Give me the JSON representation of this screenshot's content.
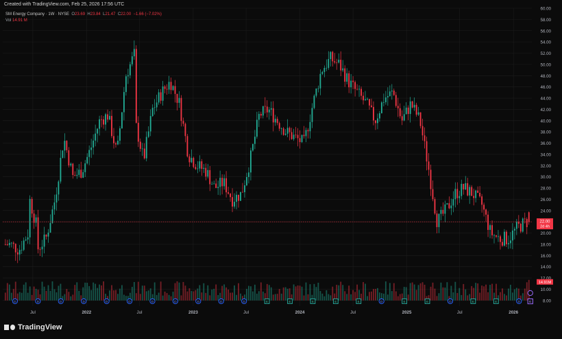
{
  "header": {
    "created_text": "Created with TradingView.com, Feb 25, 2026 17:56 UTC"
  },
  "legend": {
    "symbol_line": "SM Energy Company · 1W · NYSE",
    "o_label": "O",
    "o_value": "23.69",
    "h_label": "H",
    "h_value": "23.84",
    "l_label": "L",
    "l_value": "21.47",
    "c_label": "C",
    "c_value": "22.00",
    "change": "−1.66 (−7.02%)",
    "vol_label": "Vol",
    "vol_value": "14.91 M"
  },
  "footer": {
    "brand": "TradingView"
  },
  "colors": {
    "up": "#22ab94",
    "down": "#f23645",
    "background": "#0b0b0b",
    "grid": "#1c1c1c",
    "text": "#b2b5be"
  },
  "chart_data": {
    "type": "candlestick",
    "symbol": "SM Energy Company",
    "interval": "1W",
    "exchange": "NYSE",
    "last_price": 22.0,
    "last_price_label": "22.00",
    "last_price_countdown": "2d 4h",
    "last_volume_label": "14.91M",
    "y_ticks": [
      "8.00",
      "10.00",
      "12.00",
      "14.00",
      "16.00",
      "18.00",
      "20.00",
      "22.00",
      "24.00",
      "26.00",
      "28.00",
      "30.00",
      "32.00",
      "34.00",
      "36.00",
      "38.00",
      "40.00",
      "42.00",
      "44.00",
      "46.00",
      "48.00",
      "50.00",
      "52.00",
      "54.00",
      "56.00",
      "58.00",
      "60.00"
    ],
    "ylim": [
      7,
      60
    ],
    "x_ticks": [
      "Jul",
      "2022",
      "Jul",
      "2023",
      "Jul",
      "2024",
      "Jul",
      "2025",
      "Jul",
      "2026"
    ],
    "x_tick_bold": [
      false,
      true,
      false,
      true,
      false,
      true,
      false,
      true,
      false,
      true
    ],
    "price_anchors": [
      [
        "2021-04",
        18
      ],
      [
        "2021-05",
        17
      ],
      [
        "2021-06",
        20
      ],
      [
        "2021-06",
        27
      ],
      [
        "2021-07",
        21
      ],
      [
        "2021-07",
        17
      ],
      [
        "2021-08",
        19
      ],
      [
        "2021-09",
        26
      ],
      [
        "2021-10",
        37
      ],
      [
        "2021-11",
        30
      ],
      [
        "2021-12",
        31
      ],
      [
        "2022-01",
        35
      ],
      [
        "2022-02",
        40
      ],
      [
        "2022-03",
        41
      ],
      [
        "2022-04",
        34
      ],
      [
        "2022-05",
        48
      ],
      [
        "2022-06",
        52
      ],
      [
        "2022-06",
        40
      ],
      [
        "2022-07",
        33
      ],
      [
        "2022-08",
        42
      ],
      [
        "2022-09",
        45
      ],
      [
        "2022-10",
        47
      ],
      [
        "2022-11",
        43
      ],
      [
        "2022-12",
        34
      ],
      [
        "2023-01",
        32
      ],
      [
        "2023-02",
        31
      ],
      [
        "2023-03",
        28
      ],
      [
        "2023-04",
        29
      ],
      [
        "2023-05",
        26
      ],
      [
        "2023-06",
        27
      ],
      [
        "2023-07",
        33
      ],
      [
        "2023-08",
        41
      ],
      [
        "2023-09",
        42
      ],
      [
        "2023-10",
        40
      ],
      [
        "2023-11",
        38
      ],
      [
        "2023-12",
        37
      ],
      [
        "2024-01",
        36
      ],
      [
        "2024-02",
        43
      ],
      [
        "2024-03",
        49
      ],
      [
        "2024-04",
        51
      ],
      [
        "2024-05",
        50
      ],
      [
        "2024-06",
        47
      ],
      [
        "2024-07",
        45
      ],
      [
        "2024-08",
        43
      ],
      [
        "2024-09",
        40
      ],
      [
        "2024-10",
        44
      ],
      [
        "2024-11",
        45
      ],
      [
        "2024-12",
        40
      ],
      [
        "2025-01",
        43
      ],
      [
        "2025-02",
        40
      ],
      [
        "2025-03",
        32
      ],
      [
        "2025-04",
        22
      ],
      [
        "2025-05",
        24
      ],
      [
        "2025-06",
        27
      ],
      [
        "2025-07",
        28
      ],
      [
        "2025-08",
        27
      ],
      [
        "2025-09",
        25
      ],
      [
        "2025-10",
        20
      ],
      [
        "2025-11",
        19
      ],
      [
        "2025-12",
        19
      ],
      [
        "2026-01",
        21
      ],
      [
        "2026-02",
        22
      ]
    ],
    "event_markers": [
      "D",
      "D",
      "D",
      "D",
      "D",
      "D",
      "D",
      "D",
      "D",
      "D",
      "D",
      "E",
      "E",
      "E",
      "E",
      "E",
      "D",
      "E",
      "E",
      "D",
      "E",
      "E",
      "D"
    ]
  }
}
